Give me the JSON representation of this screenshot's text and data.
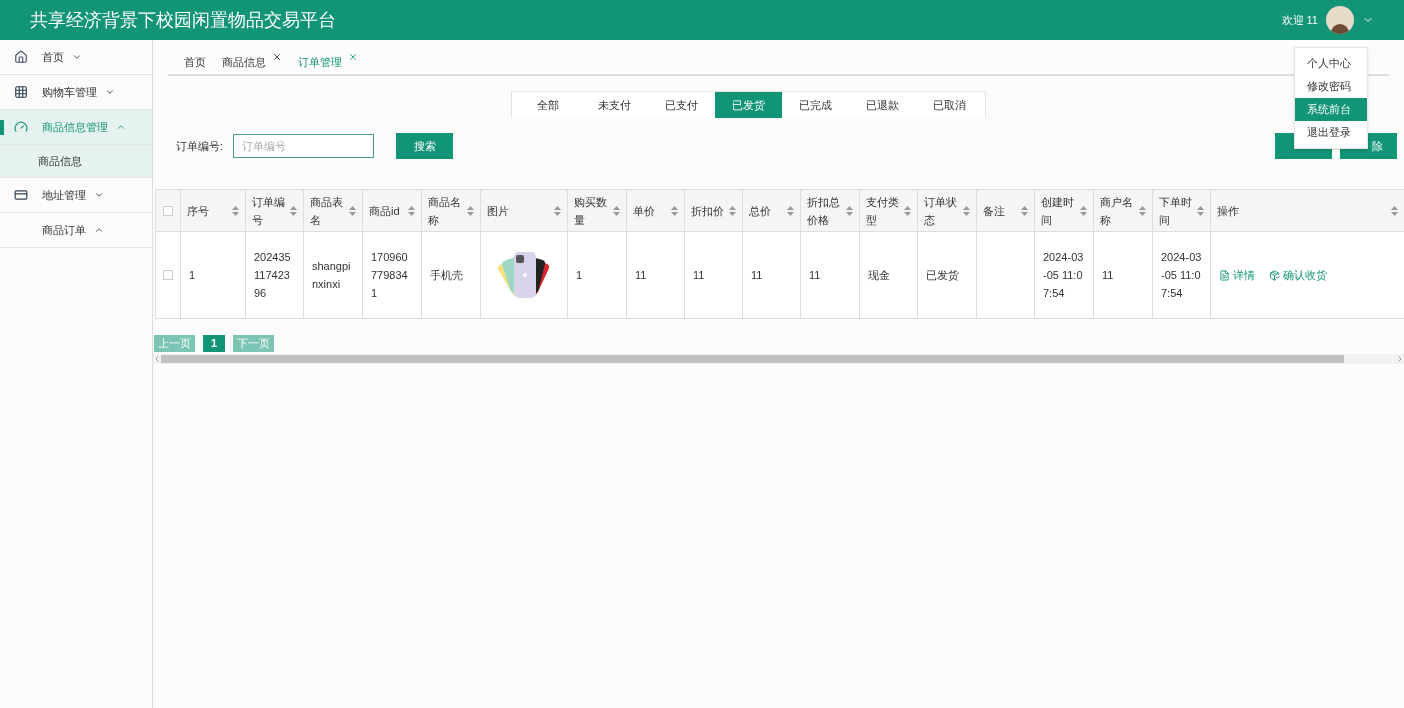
{
  "header": {
    "title": "共享经济背景下校园闲置物品交易平台",
    "welcome": "欢迎 11"
  },
  "user_menu": [
    {
      "label": "个人中心",
      "selected": false
    },
    {
      "label": "修改密码",
      "selected": false
    },
    {
      "label": "系统前台",
      "selected": true
    },
    {
      "label": "退出登录",
      "selected": false
    }
  ],
  "sidebar": {
    "items": [
      {
        "label": "首页",
        "expanded": false,
        "selected": false
      },
      {
        "label": "购物车管理",
        "expanded": false,
        "selected": false
      },
      {
        "label": "商品信息管理",
        "expanded": true,
        "selected": true,
        "children": [
          {
            "label": "商品信息"
          }
        ]
      },
      {
        "label": "地址管理",
        "expanded": false,
        "selected": false
      },
      {
        "label": "商品订单",
        "expanded": true,
        "selected": false
      }
    ]
  },
  "page_tabs": [
    {
      "label": "首页",
      "closable": false,
      "selected": false
    },
    {
      "label": "商品信息",
      "closable": true,
      "selected": false
    },
    {
      "label": "订单管理",
      "closable": true,
      "selected": true
    }
  ],
  "status_tabs": [
    {
      "label": "全部",
      "selected": false
    },
    {
      "label": "未支付",
      "selected": false
    },
    {
      "label": "已支付",
      "selected": false
    },
    {
      "label": "已发货",
      "selected": true
    },
    {
      "label": "已完成",
      "selected": false
    },
    {
      "label": "已退款",
      "selected": false
    },
    {
      "label": "已取消",
      "selected": false
    }
  ],
  "search": {
    "label": "订单编号:",
    "placeholder": "订单编号",
    "button": "搜索"
  },
  "actions": {
    "delete": "除"
  },
  "table": {
    "all_checked": false,
    "columns": [
      "序号",
      "订单编号",
      "商品表名",
      "商品id",
      "商品名称",
      "图片",
      "购买数量",
      "单价",
      "折扣价",
      "总价",
      "折扣总价格",
      "支付类型",
      "订单状态",
      "备注",
      "创建时间",
      "商户名称",
      "下单时间",
      "操作"
    ],
    "rows": [
      {
        "checked": false,
        "cells": [
          "1",
          "20243511742396",
          "shangpinxinxi",
          "1709607798341",
          "手机壳",
          null,
          "1",
          "11",
          "11",
          "11",
          "11",
          "现金",
          "已发货",
          "",
          "2024-03-05 11:07:54",
          "11",
          "2024-03-05 11:07:54"
        ],
        "detail": "详情",
        "confirm": "确认收货"
      }
    ]
  },
  "pagination": {
    "prev": "上一页",
    "pages": [
      {
        "label": "1",
        "selected": true
      }
    ],
    "next": "下一页"
  }
}
